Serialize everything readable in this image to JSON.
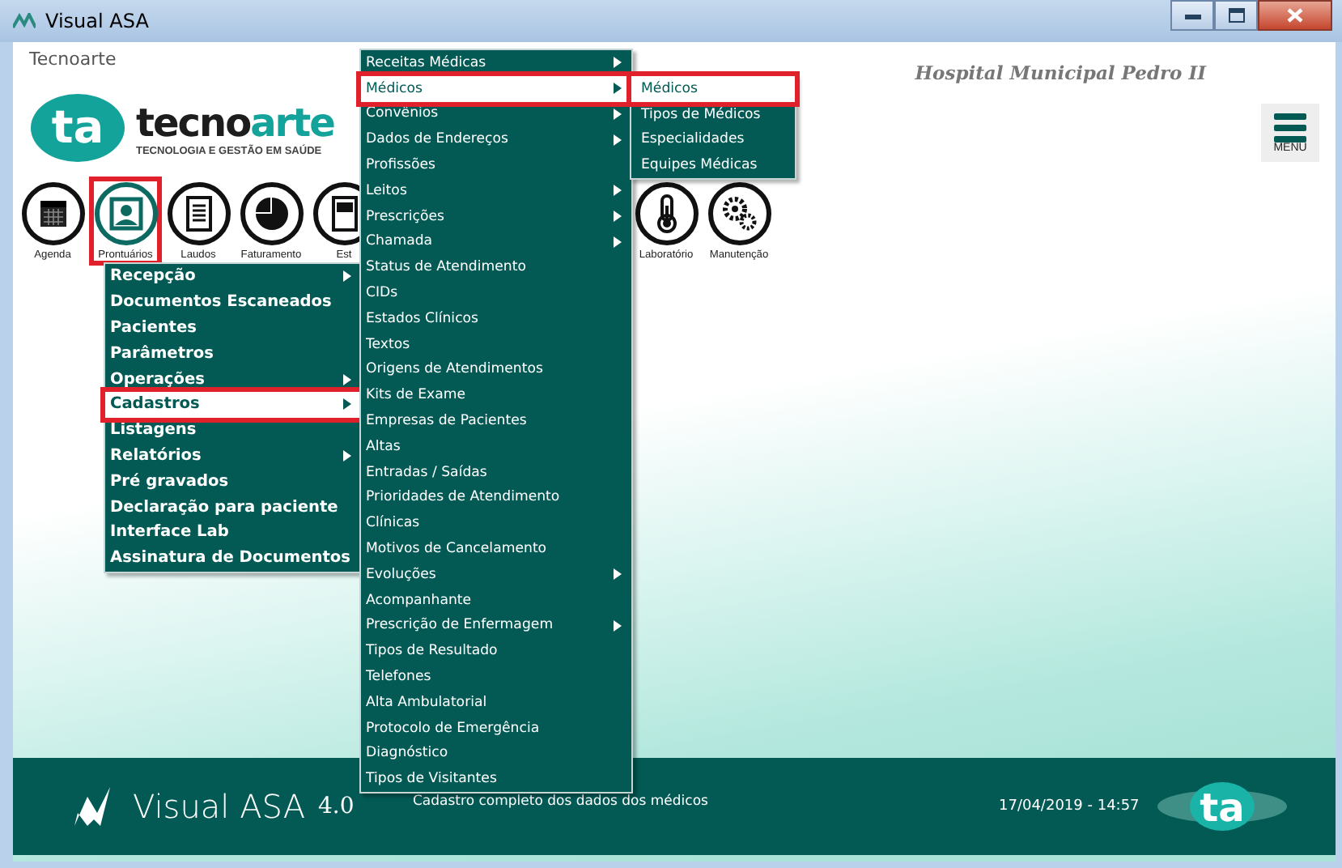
{
  "window": {
    "title": "Visual ASA"
  },
  "header": {
    "company": "Tecnoarte",
    "logo_mark": "ta",
    "logo_word_dark": "tecno",
    "logo_word_accent": "arte",
    "logo_tagline": "TECNOLOGIA E GESTÃO EM SAÚDE",
    "hospital": "Hospital Municipal Pedro II",
    "menu_button": "MENU"
  },
  "toolbar": [
    {
      "label": "Agenda",
      "kind": "calendar",
      "selected": false
    },
    {
      "label": "Prontuários",
      "kind": "portrait",
      "selected": true
    },
    {
      "label": "Laudos",
      "kind": "document",
      "selected": false
    },
    {
      "label": "Faturamento",
      "kind": "pie",
      "selected": false
    },
    {
      "label": "Est",
      "kind": "panel",
      "selected": false
    }
  ],
  "toolbar_right": [
    {
      "label": "Laboratório",
      "kind": "thermometer",
      "selected": false
    },
    {
      "label": "Manutenção",
      "kind": "gears",
      "selected": false
    }
  ],
  "menus": [
    {
      "items": [
        {
          "label": "Recepção",
          "submenu": true,
          "selected": false
        },
        {
          "label": "Documentos Escaneados",
          "submenu": false,
          "selected": false
        },
        {
          "label": "Pacientes",
          "submenu": false,
          "selected": false
        },
        {
          "label": "Parâmetros",
          "submenu": false,
          "selected": false
        },
        {
          "label": "Operações",
          "submenu": true,
          "selected": false
        },
        {
          "label": "Cadastros",
          "submenu": true,
          "selected": true
        },
        {
          "label": "Listagens",
          "submenu": false,
          "selected": false
        },
        {
          "label": "Relatórios",
          "submenu": true,
          "selected": false
        },
        {
          "label": "Pré gravados",
          "submenu": false,
          "selected": false
        },
        {
          "label": "Declaração para paciente",
          "submenu": false,
          "selected": false
        },
        {
          "label": "Interface Lab",
          "submenu": false,
          "selected": false
        },
        {
          "label": "Assinatura de Documentos",
          "submenu": false,
          "selected": false
        }
      ]
    },
    {
      "items": [
        {
          "label": "Receitas Médicas",
          "submenu": true,
          "selected": false
        },
        {
          "label": "Médicos",
          "submenu": true,
          "selected": true
        },
        {
          "label": "Convênios",
          "submenu": true,
          "selected": false
        },
        {
          "label": "Dados de Endereços",
          "submenu": true,
          "selected": false
        },
        {
          "label": "Profissões",
          "submenu": false,
          "selected": false
        },
        {
          "label": "Leitos",
          "submenu": true,
          "selected": false
        },
        {
          "label": "Prescrições",
          "submenu": true,
          "selected": false
        },
        {
          "label": "Chamada",
          "submenu": true,
          "selected": false
        },
        {
          "label": "Status de Atendimento",
          "submenu": false,
          "selected": false
        },
        {
          "label": "CIDs",
          "submenu": false,
          "selected": false
        },
        {
          "label": "Estados Clínicos",
          "submenu": false,
          "selected": false
        },
        {
          "label": "Textos",
          "submenu": false,
          "selected": false
        },
        {
          "label": "Origens de Atendimentos",
          "submenu": false,
          "selected": false
        },
        {
          "label": "Kits de Exame",
          "submenu": false,
          "selected": false
        },
        {
          "label": "Empresas de Pacientes",
          "submenu": false,
          "selected": false
        },
        {
          "label": "Altas",
          "submenu": false,
          "selected": false
        },
        {
          "label": "Entradas / Saídas",
          "submenu": false,
          "selected": false
        },
        {
          "label": "Prioridades de Atendimento",
          "submenu": false,
          "selected": false
        },
        {
          "label": "Clínicas",
          "submenu": false,
          "selected": false
        },
        {
          "label": "Motivos de Cancelamento",
          "submenu": false,
          "selected": false
        },
        {
          "label": "Evoluções",
          "submenu": true,
          "selected": false
        },
        {
          "label": "Acompanhante",
          "submenu": false,
          "selected": false
        },
        {
          "label": "Prescrição de Enfermagem",
          "submenu": true,
          "selected": false
        },
        {
          "label": "Tipos de Resultado",
          "submenu": false,
          "selected": false
        },
        {
          "label": "Telefones",
          "submenu": false,
          "selected": false
        },
        {
          "label": "Alta Ambulatorial",
          "submenu": false,
          "selected": false
        },
        {
          "label": "Protocolo de Emergência",
          "submenu": false,
          "selected": false
        },
        {
          "label": "Diagnóstico",
          "submenu": false,
          "selected": false
        },
        {
          "label": "Tipos de Visitantes",
          "submenu": false,
          "selected": false
        }
      ]
    },
    {
      "items": [
        {
          "label": "Médicos",
          "submenu": false,
          "selected": true
        },
        {
          "label": "Tipos de Médicos",
          "submenu": false,
          "selected": false
        },
        {
          "label": "Especialidades",
          "submenu": false,
          "selected": false
        },
        {
          "label": "Equipes Médicas",
          "submenu": false,
          "selected": false
        }
      ]
    }
  ],
  "footer": {
    "product": "Visual ASA",
    "version": "4.0",
    "status": "Cadastro completo dos dados dos médicos",
    "datetime": "17/04/2019 - 14:57",
    "logo_mark": "ta"
  }
}
